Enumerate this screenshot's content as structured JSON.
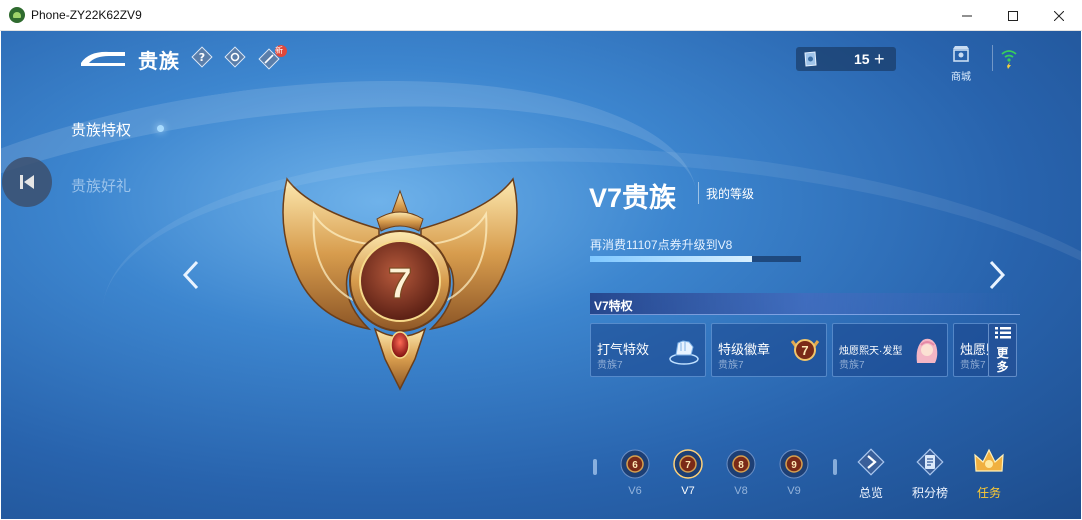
{
  "window": {
    "title": "Phone-ZY22K62ZV9"
  },
  "header": {
    "title": "贵族",
    "new_badge": "新"
  },
  "sidebar": {
    "items": [
      {
        "label": "贵族特权"
      },
      {
        "label": "贵族好礼"
      }
    ]
  },
  "currency": {
    "amount": "15",
    "add_symbol": "+"
  },
  "shop": {
    "label": "商城"
  },
  "emblem": {
    "level": "7"
  },
  "rank": {
    "title": "V7贵族",
    "my_level": "我的等级",
    "upgrade_text": "再消费11107点券升级到V8",
    "progress": 0.77
  },
  "privileges": {
    "header": "V7特权",
    "cards": [
      {
        "name": "打气特效",
        "sub": "贵族7",
        "icon": "fist-bump-icon"
      },
      {
        "name": "特级徽章",
        "sub": "贵族7",
        "icon": "v7-badge-icon"
      },
      {
        "name": "烛愿熙天·发型",
        "sub": "贵族7",
        "icon": "hero-avatar-icon"
      },
      {
        "name": "烛愿熙",
        "sub": "贵族7",
        "icon": "hero-avatar-icon"
      }
    ],
    "more_label_1": "更",
    "more_label_2": "多"
  },
  "levels": [
    {
      "number": "6",
      "label": "V6"
    },
    {
      "number": "7",
      "label": "V7"
    },
    {
      "number": "8",
      "label": "V8"
    },
    {
      "number": "9",
      "label": "V9"
    }
  ],
  "bottom_nav": {
    "overview": "总览",
    "leaderboard": "积分榜",
    "tasks": "任务"
  },
  "colors": {
    "accent_gold": "#ffcc33",
    "progress_fill": "#bfe4ff",
    "bg_blue": "#3d86cf"
  }
}
